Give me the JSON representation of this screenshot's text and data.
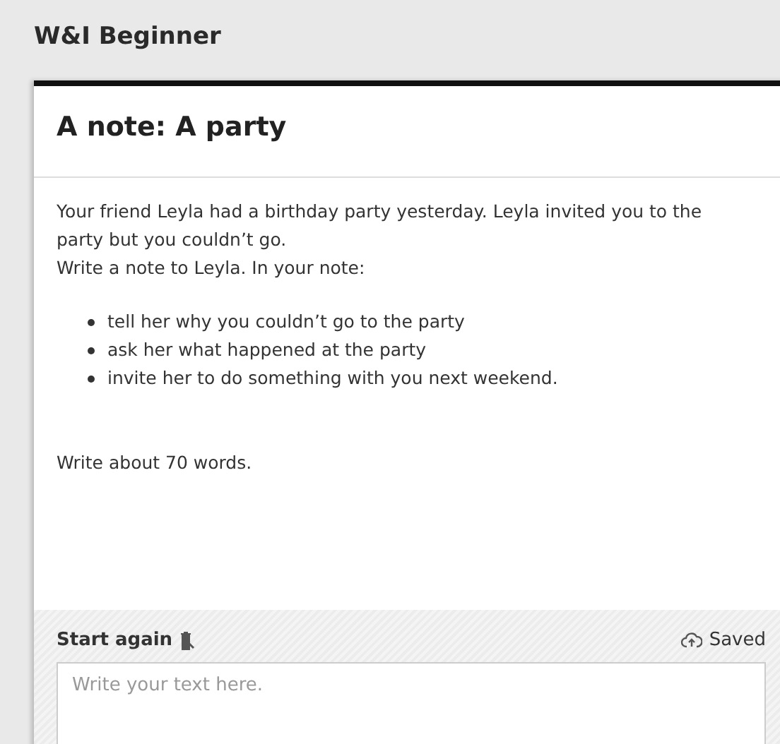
{
  "header": {
    "title": "W&I Beginner"
  },
  "task": {
    "title": "A note: A party",
    "paragraphs": [
      "Your friend Leyla had a birthday party yesterday. Leyla invited you to the party but you couldn’t go.",
      "Write a note to Leyla. In your note:"
    ],
    "bullets": [
      "tell her why you couldn’t go to the party",
      "ask her what happened at the party",
      "invite her to do something with you next weekend."
    ],
    "word_count": "Write about 70 words."
  },
  "editor": {
    "start_again": "Start again",
    "status": "Saved",
    "placeholder": "Write your text here."
  }
}
